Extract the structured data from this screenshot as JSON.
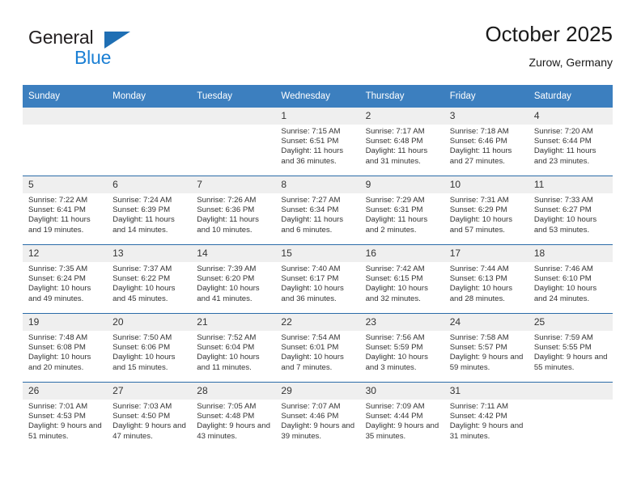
{
  "brand": {
    "name_top": "General",
    "name_bottom": "Blue",
    "accent_color": "#1a7fd4",
    "triangle_color": "#1f6fb4"
  },
  "header": {
    "title": "October 2025",
    "subtitle": "Zurow, Germany"
  },
  "theme": {
    "header_row_bg": "#3c7fbf",
    "row_divider": "#2b6ca8",
    "daynum_bg": "#efefef",
    "text": "#333333"
  },
  "weekday_headers": [
    "Sunday",
    "Monday",
    "Tuesday",
    "Wednesday",
    "Thursday",
    "Friday",
    "Saturday"
  ],
  "labels": {
    "sunrise": "Sunrise:",
    "sunset": "Sunset:",
    "daylight": "Daylight:"
  },
  "weeks": [
    [
      {
        "day": "",
        "empty": true
      },
      {
        "day": "",
        "empty": true
      },
      {
        "day": "",
        "empty": true
      },
      {
        "day": "1",
        "sunrise": "Sunrise: 7:15 AM",
        "sunset": "Sunset: 6:51 PM",
        "daylight": "Daylight: 11 hours and 36 minutes."
      },
      {
        "day": "2",
        "sunrise": "Sunrise: 7:17 AM",
        "sunset": "Sunset: 6:48 PM",
        "daylight": "Daylight: 11 hours and 31 minutes."
      },
      {
        "day": "3",
        "sunrise": "Sunrise: 7:18 AM",
        "sunset": "Sunset: 6:46 PM",
        "daylight": "Daylight: 11 hours and 27 minutes."
      },
      {
        "day": "4",
        "sunrise": "Sunrise: 7:20 AM",
        "sunset": "Sunset: 6:44 PM",
        "daylight": "Daylight: 11 hours and 23 minutes."
      }
    ],
    [
      {
        "day": "5",
        "sunrise": "Sunrise: 7:22 AM",
        "sunset": "Sunset: 6:41 PM",
        "daylight": "Daylight: 11 hours and 19 minutes."
      },
      {
        "day": "6",
        "sunrise": "Sunrise: 7:24 AM",
        "sunset": "Sunset: 6:39 PM",
        "daylight": "Daylight: 11 hours and 14 minutes."
      },
      {
        "day": "7",
        "sunrise": "Sunrise: 7:26 AM",
        "sunset": "Sunset: 6:36 PM",
        "daylight": "Daylight: 11 hours and 10 minutes."
      },
      {
        "day": "8",
        "sunrise": "Sunrise: 7:27 AM",
        "sunset": "Sunset: 6:34 PM",
        "daylight": "Daylight: 11 hours and 6 minutes."
      },
      {
        "day": "9",
        "sunrise": "Sunrise: 7:29 AM",
        "sunset": "Sunset: 6:31 PM",
        "daylight": "Daylight: 11 hours and 2 minutes."
      },
      {
        "day": "10",
        "sunrise": "Sunrise: 7:31 AM",
        "sunset": "Sunset: 6:29 PM",
        "daylight": "Daylight: 10 hours and 57 minutes."
      },
      {
        "day": "11",
        "sunrise": "Sunrise: 7:33 AM",
        "sunset": "Sunset: 6:27 PM",
        "daylight": "Daylight: 10 hours and 53 minutes."
      }
    ],
    [
      {
        "day": "12",
        "sunrise": "Sunrise: 7:35 AM",
        "sunset": "Sunset: 6:24 PM",
        "daylight": "Daylight: 10 hours and 49 minutes."
      },
      {
        "day": "13",
        "sunrise": "Sunrise: 7:37 AM",
        "sunset": "Sunset: 6:22 PM",
        "daylight": "Daylight: 10 hours and 45 minutes."
      },
      {
        "day": "14",
        "sunrise": "Sunrise: 7:39 AM",
        "sunset": "Sunset: 6:20 PM",
        "daylight": "Daylight: 10 hours and 41 minutes."
      },
      {
        "day": "15",
        "sunrise": "Sunrise: 7:40 AM",
        "sunset": "Sunset: 6:17 PM",
        "daylight": "Daylight: 10 hours and 36 minutes."
      },
      {
        "day": "16",
        "sunrise": "Sunrise: 7:42 AM",
        "sunset": "Sunset: 6:15 PM",
        "daylight": "Daylight: 10 hours and 32 minutes."
      },
      {
        "day": "17",
        "sunrise": "Sunrise: 7:44 AM",
        "sunset": "Sunset: 6:13 PM",
        "daylight": "Daylight: 10 hours and 28 minutes."
      },
      {
        "day": "18",
        "sunrise": "Sunrise: 7:46 AM",
        "sunset": "Sunset: 6:10 PM",
        "daylight": "Daylight: 10 hours and 24 minutes."
      }
    ],
    [
      {
        "day": "19",
        "sunrise": "Sunrise: 7:48 AM",
        "sunset": "Sunset: 6:08 PM",
        "daylight": "Daylight: 10 hours and 20 minutes."
      },
      {
        "day": "20",
        "sunrise": "Sunrise: 7:50 AM",
        "sunset": "Sunset: 6:06 PM",
        "daylight": "Daylight: 10 hours and 15 minutes."
      },
      {
        "day": "21",
        "sunrise": "Sunrise: 7:52 AM",
        "sunset": "Sunset: 6:04 PM",
        "daylight": "Daylight: 10 hours and 11 minutes."
      },
      {
        "day": "22",
        "sunrise": "Sunrise: 7:54 AM",
        "sunset": "Sunset: 6:01 PM",
        "daylight": "Daylight: 10 hours and 7 minutes."
      },
      {
        "day": "23",
        "sunrise": "Sunrise: 7:56 AM",
        "sunset": "Sunset: 5:59 PM",
        "daylight": "Daylight: 10 hours and 3 minutes."
      },
      {
        "day": "24",
        "sunrise": "Sunrise: 7:58 AM",
        "sunset": "Sunset: 5:57 PM",
        "daylight": "Daylight: 9 hours and 59 minutes."
      },
      {
        "day": "25",
        "sunrise": "Sunrise: 7:59 AM",
        "sunset": "Sunset: 5:55 PM",
        "daylight": "Daylight: 9 hours and 55 minutes."
      }
    ],
    [
      {
        "day": "26",
        "sunrise": "Sunrise: 7:01 AM",
        "sunset": "Sunset: 4:53 PM",
        "daylight": "Daylight: 9 hours and 51 minutes."
      },
      {
        "day": "27",
        "sunrise": "Sunrise: 7:03 AM",
        "sunset": "Sunset: 4:50 PM",
        "daylight": "Daylight: 9 hours and 47 minutes."
      },
      {
        "day": "28",
        "sunrise": "Sunrise: 7:05 AM",
        "sunset": "Sunset: 4:48 PM",
        "daylight": "Daylight: 9 hours and 43 minutes."
      },
      {
        "day": "29",
        "sunrise": "Sunrise: 7:07 AM",
        "sunset": "Sunset: 4:46 PM",
        "daylight": "Daylight: 9 hours and 39 minutes."
      },
      {
        "day": "30",
        "sunrise": "Sunrise: 7:09 AM",
        "sunset": "Sunset: 4:44 PM",
        "daylight": "Daylight: 9 hours and 35 minutes."
      },
      {
        "day": "31",
        "sunrise": "Sunrise: 7:11 AM",
        "sunset": "Sunset: 4:42 PM",
        "daylight": "Daylight: 9 hours and 31 minutes."
      },
      {
        "day": "",
        "empty": true
      }
    ]
  ]
}
